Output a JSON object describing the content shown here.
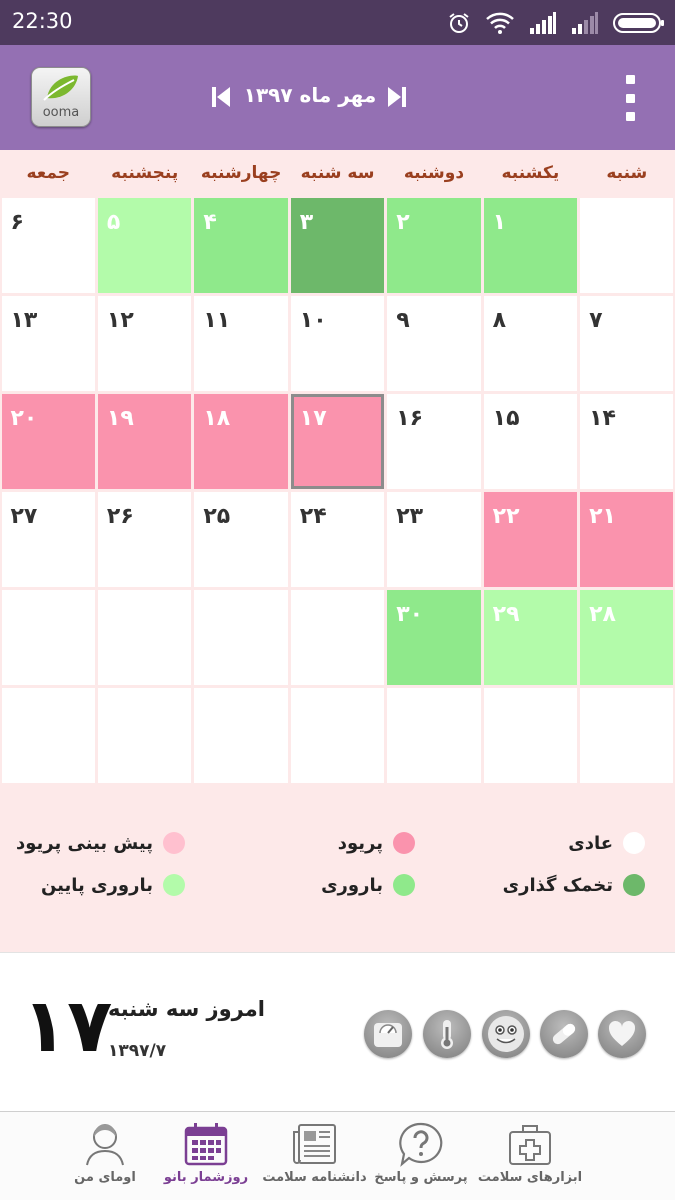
{
  "status_bar": {
    "time": "22:30",
    "icons": [
      "alarm-icon",
      "wifi-icon",
      "signal-icon",
      "signal-weak-icon",
      "battery-icon"
    ]
  },
  "app_bar": {
    "logo_text": "ooma",
    "month_title": "مهر ماه ۱۳۹۷",
    "prev_icon": "skip-previous-icon",
    "next_icon": "skip-next-icon",
    "menu_icon": "more-vertical-icon"
  },
  "colors": {
    "status_bar": "#4e3a5e",
    "app_bar": "#9470b3",
    "calendar_bg": "#fde9e9",
    "weekday_text": "#9a3f1f",
    "period": "#fa93ad",
    "period_forecast": "#ffc0cf",
    "fertile": "#8fe98b",
    "low_fertile": "#b3fbaa",
    "ovulation": "#6db86a",
    "normal": "#ffffff",
    "nav_active": "#7b3f93"
  },
  "calendar": {
    "weekdays": [
      "شنبه",
      "یکشنبه",
      "دوشنبه",
      "سه شنبه",
      "چهارشنبه",
      "پنجشنبه",
      "جمعه"
    ],
    "weeks": [
      [
        {
          "label": "",
          "type": "normal"
        },
        {
          "label": "۱",
          "type": "fertile"
        },
        {
          "label": "۲",
          "type": "fertile"
        },
        {
          "label": "۳",
          "type": "ovulation"
        },
        {
          "label": "۴",
          "type": "fertile"
        },
        {
          "label": "۵",
          "type": "low"
        },
        {
          "label": "۶",
          "type": "normal"
        }
      ],
      [
        {
          "label": "۷",
          "type": "normal"
        },
        {
          "label": "۸",
          "type": "normal"
        },
        {
          "label": "۹",
          "type": "normal"
        },
        {
          "label": "۱۰",
          "type": "normal"
        },
        {
          "label": "۱۱",
          "type": "normal"
        },
        {
          "label": "۱۲",
          "type": "normal"
        },
        {
          "label": "۱۳",
          "type": "normal"
        }
      ],
      [
        {
          "label": "۱۴",
          "type": "normal"
        },
        {
          "label": "۱۵",
          "type": "normal"
        },
        {
          "label": "۱۶",
          "type": "normal"
        },
        {
          "label": "۱۷",
          "type": "period",
          "today": true
        },
        {
          "label": "۱۸",
          "type": "period"
        },
        {
          "label": "۱۹",
          "type": "period"
        },
        {
          "label": "۲۰",
          "type": "period"
        }
      ],
      [
        {
          "label": "۲۱",
          "type": "period"
        },
        {
          "label": "۲۲",
          "type": "period"
        },
        {
          "label": "۲۳",
          "type": "normal"
        },
        {
          "label": "۲۴",
          "type": "normal"
        },
        {
          "label": "۲۵",
          "type": "normal"
        },
        {
          "label": "۲۶",
          "type": "normal"
        },
        {
          "label": "۲۷",
          "type": "normal"
        }
      ],
      [
        {
          "label": "۲۸",
          "type": "low"
        },
        {
          "label": "۲۹",
          "type": "low"
        },
        {
          "label": "۳۰",
          "type": "fertile"
        },
        {
          "label": "",
          "type": "normal"
        },
        {
          "label": "",
          "type": "normal"
        },
        {
          "label": "",
          "type": "normal"
        },
        {
          "label": "",
          "type": "normal"
        }
      ],
      [
        {
          "label": "",
          "type": "normal"
        },
        {
          "label": "",
          "type": "normal"
        },
        {
          "label": "",
          "type": "normal"
        },
        {
          "label": "",
          "type": "normal"
        },
        {
          "label": "",
          "type": "normal"
        },
        {
          "label": "",
          "type": "normal"
        },
        {
          "label": "",
          "type": "normal"
        }
      ]
    ]
  },
  "legend": {
    "normal": "عادی",
    "period": "پریود",
    "period_forecast": "پیش بینی پریود",
    "ovulation": "تخمک گذاری",
    "fertile": "باروری",
    "low_fertile": "باروری پایین"
  },
  "today": {
    "day_number": "۱۷",
    "label": "امروز سه شنبه",
    "date": "۱۳۹۷/۷"
  },
  "tools": [
    "heart-icon",
    "pill-icon",
    "smiley-icon",
    "thermometer-icon",
    "scale-icon"
  ],
  "bottom_nav": [
    {
      "key": "my-ooma",
      "label": "اومای من",
      "icon": "profile-icon"
    },
    {
      "key": "calendar",
      "label": "روزشمار بانو",
      "icon": "calendar-icon",
      "active": true
    },
    {
      "key": "encyclopedia",
      "label": "دانشنامه سلامت",
      "icon": "newspaper-icon"
    },
    {
      "key": "qa",
      "label": "پرسش و پاسخ",
      "icon": "question-icon"
    },
    {
      "key": "tools",
      "label": "ابزارهای سلامت",
      "icon": "first-aid-icon"
    }
  ]
}
